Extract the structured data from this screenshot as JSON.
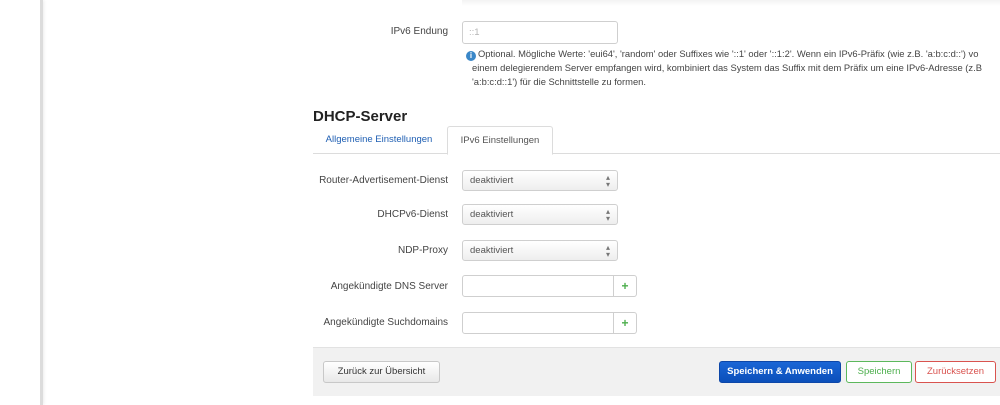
{
  "ipv6_suffix": {
    "label": "IPv6 Endung",
    "value": "::1",
    "help_lines": [
      "Optional. Mögliche Werte: 'eui64', 'random' oder Suffixes wie '::1' oder '::1:2'. Wenn ein IPv6-Präfix (wie z.B. 'a:b:c:d::') vo",
      "einem delegierendem Server empfangen wird, kombiniert das System das Suffix mit dem Präfix um eine IPv6-Adresse (z.B",
      "'a:b:c:d::1') für die Schnittstelle zu formen."
    ]
  },
  "dhcp": {
    "title": "DHCP-Server",
    "tabs": [
      {
        "label": "Allgemeine Einstellungen",
        "active": false
      },
      {
        "label": "IPv6 Einstellungen",
        "active": true
      }
    ],
    "fields": {
      "ra_service": {
        "label": "Router-Advertisement-Dienst",
        "value": "deaktiviert"
      },
      "dhcpv6_service": {
        "label": "DHCPv6-Dienst",
        "value": "deaktiviert"
      },
      "ndp_proxy": {
        "label": "NDP-Proxy",
        "value": "deaktiviert"
      },
      "dns_servers": {
        "label": "Angekündigte DNS Server",
        "value": "",
        "add": "+"
      },
      "search_domains": {
        "label": "Angekündigte Suchdomains",
        "value": "",
        "add": "+"
      }
    }
  },
  "footer": {
    "back": "Zurück zur Übersicht",
    "save_apply": "Speichern & Anwenden",
    "save": "Speichern",
    "reset": "Zurücksetzen"
  },
  "colors": {
    "primary": "#1a66d6",
    "success": "#4cae4c",
    "danger": "#d9534f",
    "link": "#1f5fb3"
  },
  "icons": {
    "info": "info-icon",
    "select_caret": "select-caret-icon",
    "add": "plus-icon"
  }
}
